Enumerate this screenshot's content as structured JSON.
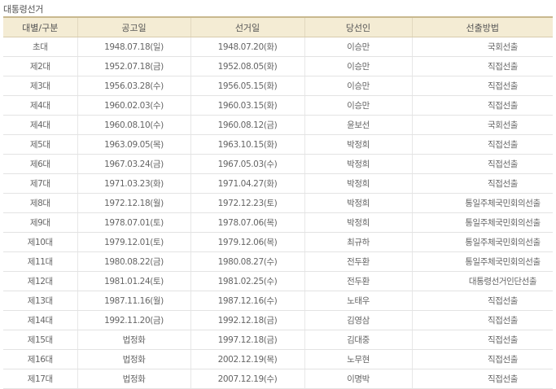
{
  "page": {
    "caption": "대통령선거"
  },
  "table": {
    "headers": [
      "대별/구분",
      "공고일",
      "선거일",
      "당선인",
      "선출방법"
    ],
    "rows": [
      [
        "초대",
        "1948.07.18(일)",
        "1948.07.20(화)",
        "이승만",
        "국회선출"
      ],
      [
        "제2대",
        "1952.07.18(금)",
        "1952.08.05(화)",
        "이승만",
        "직접선출"
      ],
      [
        "제3대",
        "1956.03.28(수)",
        "1956.05.15(화)",
        "이승만",
        "직접선출"
      ],
      [
        "제4대",
        "1960.02.03(수)",
        "1960.03.15(화)",
        "이승만",
        "직접선출"
      ],
      [
        "제4대",
        "1960.08.10(수)",
        "1960.08.12(금)",
        "윤보선",
        "국회선출"
      ],
      [
        "제5대",
        "1963.09.05(목)",
        "1963.10.15(화)",
        "박정희",
        "직접선출"
      ],
      [
        "제6대",
        "1967.03.24(금)",
        "1967.05.03(수)",
        "박정희",
        "직접선출"
      ],
      [
        "제7대",
        "1971.03.23(화)",
        "1971.04.27(화)",
        "박정희",
        "직접선출"
      ],
      [
        "제8대",
        "1972.12.18(월)",
        "1972.12.23(토)",
        "박정희",
        "통일주체국민회의선출"
      ],
      [
        "제9대",
        "1978.07.01(토)",
        "1978.07.06(목)",
        "박정희",
        "통일주체국민회의선출"
      ],
      [
        "제10대",
        "1979.12.01(토)",
        "1979.12.06(목)",
        "최규하",
        "통일주체국민회의선출"
      ],
      [
        "제11대",
        "1980.08.22(금)",
        "1980.08.27(수)",
        "전두환",
        "통일주체국민회의선출"
      ],
      [
        "제12대",
        "1981.01.24(토)",
        "1981.02.25(수)",
        "전두환",
        "대통령선거인단선출"
      ],
      [
        "제13대",
        "1987.11.16(월)",
        "1987.12.16(수)",
        "노태우",
        "직접선출"
      ],
      [
        "제14대",
        "1992.11.20(금)",
        "1992.12.18(금)",
        "김영삼",
        "직접선출"
      ],
      [
        "제15대",
        "법정화",
        "1997.12.18(금)",
        "김대중",
        "직접선출"
      ],
      [
        "제16대",
        "법정화",
        "2002.12.19(목)",
        "노무현",
        "직접선출"
      ],
      [
        "제17대",
        "법정화",
        "2007.12.19(수)",
        "이명박",
        "직접선출"
      ]
    ]
  }
}
